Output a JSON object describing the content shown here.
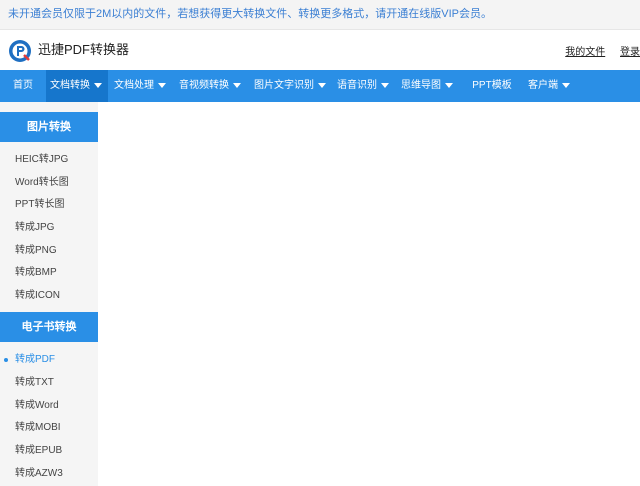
{
  "notice": {
    "text": "未开通会员仅限于2M以内的文件，若想获得更大转换文件、转换更多格式，请开通在线版VIP会员。"
  },
  "header": {
    "brand": "迅捷PDF转换器",
    "links": [
      "我的文件",
      "登录"
    ]
  },
  "nav": {
    "items": [
      {
        "label": "首页",
        "caret": false,
        "active": false
      },
      {
        "label": "文档转换",
        "caret": true,
        "active": true
      },
      {
        "label": "文档处理",
        "caret": true,
        "active": false
      },
      {
        "label": "音视频转换",
        "caret": true,
        "active": false
      },
      {
        "label": "图片文字识别",
        "caret": true,
        "active": false
      },
      {
        "label": "语音识别",
        "caret": true,
        "active": false
      },
      {
        "label": "思维导图",
        "caret": true,
        "active": false
      },
      {
        "label": "PPT模板",
        "caret": false,
        "active": false
      },
      {
        "label": "客户端",
        "caret": true,
        "active": false
      }
    ]
  },
  "sidebar": {
    "sections": [
      {
        "title": "图片转换",
        "items": [
          "HEIC转JPG",
          "Word转长图",
          "PPT转长图",
          "转成JPG",
          "转成PNG",
          "转成BMP",
          "转成ICON"
        ]
      },
      {
        "title": "电子书转换",
        "items": [
          "转成PDF",
          "转成TXT",
          "转成Word",
          "转成MOBI",
          "转成EPUB",
          "转成AZW3"
        ],
        "active_item": "转成PDF"
      }
    ]
  },
  "colors": {
    "primary": "#2a8fe6",
    "nav_active": "#1676cc",
    "notice_text": "#3b7fd3",
    "sidebar_bg": "#f5f5f5"
  }
}
